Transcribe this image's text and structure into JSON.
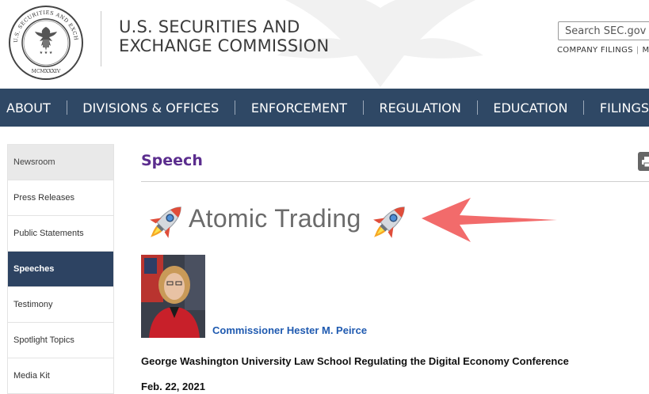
{
  "header": {
    "agency_line1": "U.S. SECURITIES AND",
    "agency_line2": "EXCHANGE COMMISSION",
    "seal_text": "U.S. SECURITIES AND EXCHANGE COMMISSION MCMXXXIV",
    "search_placeholder": "Search SEC.gov",
    "utility_links": [
      "COMPANY FILINGS",
      "M"
    ]
  },
  "nav": {
    "items": [
      "ABOUT",
      "DIVISIONS & OFFICES",
      "ENFORCEMENT",
      "REGULATION",
      "EDUCATION",
      "FILINGS"
    ]
  },
  "sidebar": {
    "items": [
      {
        "label": "Newsroom",
        "state": "shaded"
      },
      {
        "label": "Press Releases",
        "state": "normal"
      },
      {
        "label": "Public Statements",
        "state": "normal"
      },
      {
        "label": "Speeches",
        "state": "active"
      },
      {
        "label": "Testimony",
        "state": "normal"
      },
      {
        "label": "Spotlight Topics",
        "state": "normal"
      },
      {
        "label": "Media Kit",
        "state": "normal"
      }
    ]
  },
  "main": {
    "section_title": "Speech",
    "speech_title": "Atomic Trading",
    "speaker": "Commissioner Hester M. Peirce",
    "event": "George Washington University Law School Regulating the Digital Economy Conference",
    "date": "Feb. 22, 2021",
    "print_icon": "printer-icon"
  },
  "colors": {
    "nav_bg": "#2f4865",
    "title_purple": "#5b2d8e",
    "link_blue": "#1f5ab0",
    "sidebar_active": "#2d4362",
    "arrow": "#f26b6b"
  }
}
